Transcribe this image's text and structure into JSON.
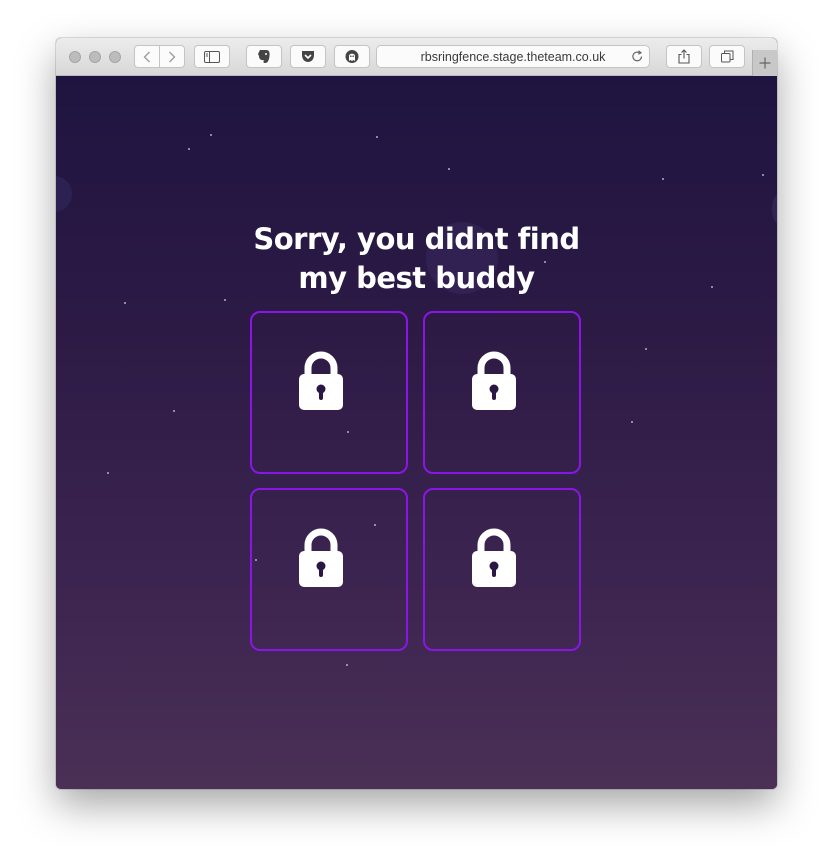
{
  "browser": {
    "url": "rbsringfence.stage.theteam.co.uk",
    "buttons": {
      "back": "chevron-left-icon",
      "forward": "chevron-right-icon",
      "sidebar": "sidebar-icon",
      "evernote": "evernote-icon",
      "pocket": "pocket-icon",
      "ghostery": "ghostery-icon",
      "reload": "reload-icon",
      "share": "share-icon",
      "tabs": "tabs-overview-icon",
      "new_tab": "plus-icon"
    }
  },
  "page": {
    "heading_line1": "Sorry, you didnt find",
    "heading_line2": "my best buddy",
    "tiles": [
      {
        "state": "locked",
        "icon": "padlock-icon"
      },
      {
        "state": "locked",
        "icon": "padlock-icon"
      },
      {
        "state": "locked",
        "icon": "padlock-icon"
      },
      {
        "state": "locked",
        "icon": "padlock-icon"
      }
    ]
  },
  "colors": {
    "background_top": "#1f1440",
    "background_bottom": "#4a3055",
    "tile_border": "#8a16e6",
    "text": "#ffffff"
  }
}
